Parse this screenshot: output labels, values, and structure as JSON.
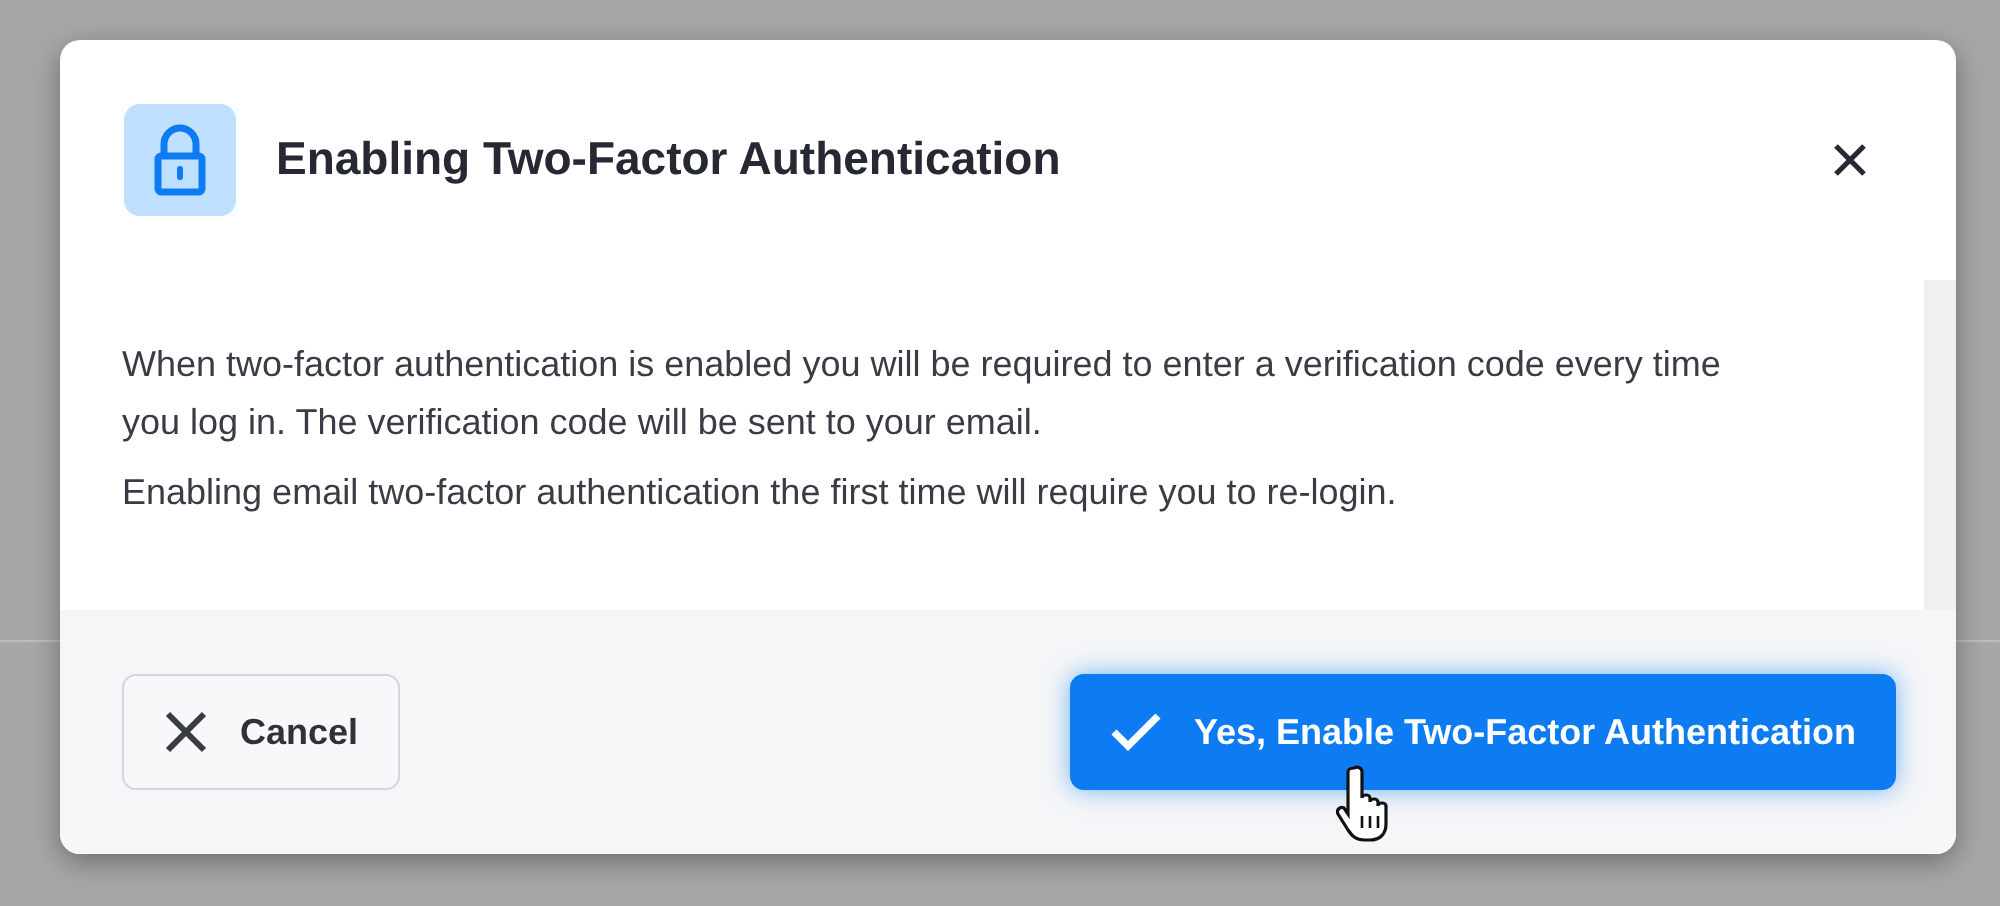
{
  "dialog": {
    "title": "Enabling Two-Factor Authentication",
    "paragraphs": [
      "When two-factor authentication is enabled you will be required to enter a verification code every time you log in. The verification code will be sent to your email.",
      "Enabling email two-factor authentication the first time will require you to re-login."
    ],
    "buttons": [
      {
        "label": "Cancel",
        "kind": "secondary",
        "hovered": false
      },
      {
        "label": "Yes, Enable Two-Factor Authentication",
        "kind": "primary",
        "hovered": true
      }
    ]
  }
}
